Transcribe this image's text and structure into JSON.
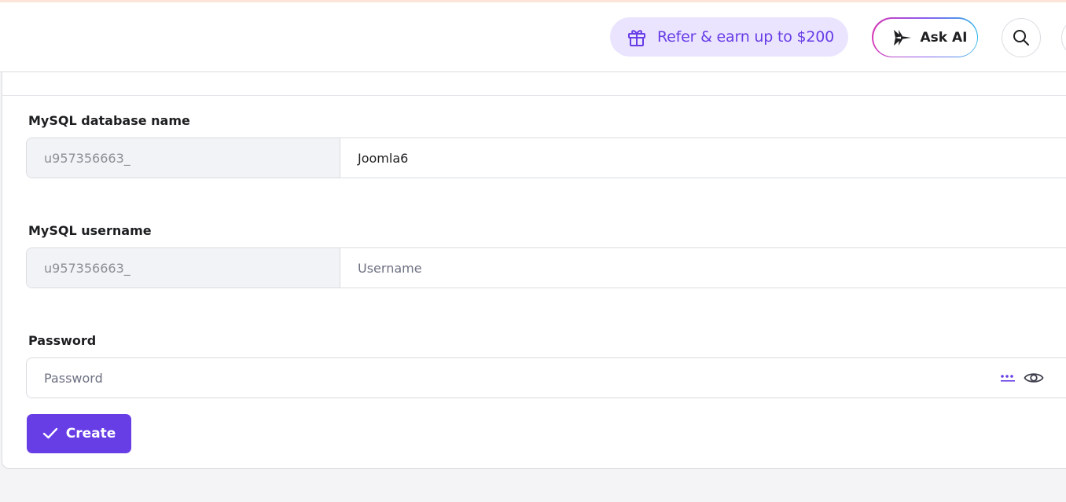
{
  "header": {
    "refer_label": "Refer & earn up to $200",
    "ask_ai_label": "Ask AI"
  },
  "form": {
    "db_name": {
      "label": "MySQL database name",
      "prefix": "u957356663_",
      "value": "Joomla6"
    },
    "username": {
      "label": "MySQL username",
      "prefix": "u957356663_",
      "placeholder": "Username"
    },
    "password": {
      "label": "Password",
      "placeholder": "Password"
    },
    "create_label": "Create"
  },
  "icons": {
    "refer": "gift-icon",
    "ask_ai": "ai-spark-icon",
    "search": "search-icon",
    "generate": "password-generate-icon",
    "visibility": "eye-icon",
    "create": "checkmark-icon"
  },
  "colors": {
    "brand": "#673de6",
    "refer_bg": "#ebe4ff",
    "prefix_bg": "#f2f3f6"
  }
}
